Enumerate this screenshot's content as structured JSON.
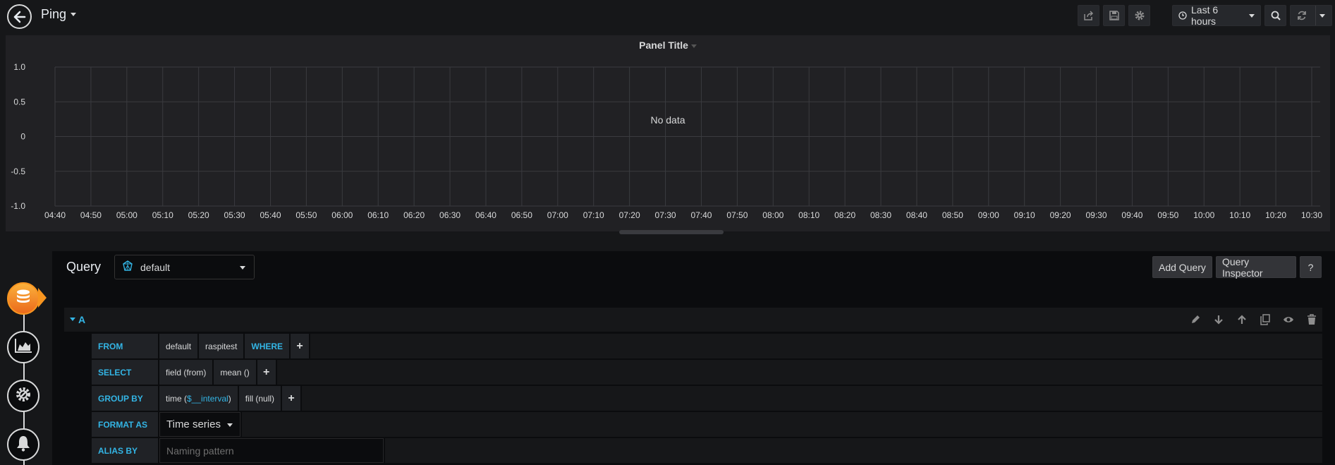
{
  "header": {
    "title": "Ping",
    "time_range": "Last 6 hours"
  },
  "panel": {
    "title": "Panel Title",
    "no_data": "No data"
  },
  "chart_data": {
    "type": "line",
    "title": "Panel Title",
    "series": [],
    "ylim": [
      -1.0,
      1.0
    ],
    "y_ticks": [
      "1.0",
      "0.5",
      "0",
      "-0.5",
      "-1.0"
    ],
    "x_ticks": [
      "04:40",
      "04:50",
      "05:00",
      "05:10",
      "05:20",
      "05:30",
      "05:40",
      "05:50",
      "06:00",
      "06:10",
      "06:20",
      "06:30",
      "06:40",
      "06:50",
      "07:00",
      "07:10",
      "07:20",
      "07:30",
      "07:40",
      "07:50",
      "08:00",
      "08:10",
      "08:20",
      "08:30",
      "08:40",
      "08:50",
      "09:00",
      "09:10",
      "09:20",
      "09:30",
      "09:40",
      "09:50",
      "10:00",
      "10:10",
      "10:20",
      "10:30"
    ],
    "grid": true,
    "annotation": "No data"
  },
  "editor": {
    "query_label": "Query",
    "datasource": "default",
    "add_query": "Add Query",
    "query_inspector": "Query Inspector",
    "help": "?"
  },
  "query": {
    "ref_id": "A",
    "from_kw": "FROM",
    "from_db": "default",
    "from_measurement": "raspitest",
    "where_kw": "WHERE",
    "select_kw": "SELECT",
    "select_field": "field (from)",
    "select_fn": "mean ()",
    "groupby_kw": "GROUP BY",
    "groupby_time_prefix": "time (",
    "groupby_time_var": "$__interval",
    "groupby_time_suffix": ")",
    "groupby_fill": "fill (null)",
    "format_kw": "FORMAT AS",
    "format_value": "Time series",
    "alias_kw": "ALIAS BY",
    "alias_placeholder": "Naming pattern",
    "plus": "+"
  },
  "colors": {
    "accent": "#33b5e5",
    "active": "#f79520",
    "background": "#161719",
    "panel": "#212124"
  }
}
